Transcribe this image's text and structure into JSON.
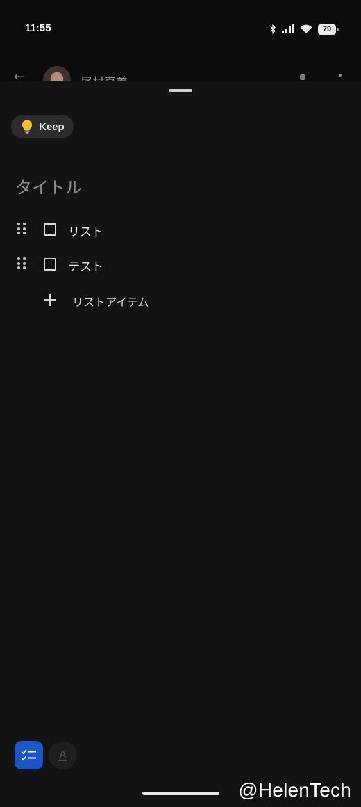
{
  "status_bar": {
    "time": "11:55",
    "battery": "79",
    "icons": [
      "bluetooth-icon",
      "cellular-signal-icon",
      "wifi-icon",
      "battery-icon"
    ]
  },
  "background_app": {
    "back_icon": "back-arrow-icon",
    "contact_name": "尾村直美"
  },
  "sheet": {
    "chip": {
      "label": "Keep",
      "icon": "lightbulb-icon",
      "icon_color": "#f6c02b"
    },
    "title_placeholder": "タイトル",
    "items": [
      {
        "text": "リスト",
        "checked": false
      },
      {
        "text": "テスト",
        "checked": false
      }
    ],
    "add_item_label": "リストアイテム"
  },
  "toolbar": {
    "checklist_icon": "checklist-icon",
    "text_format_glyph": "A",
    "accent": "#1a56c7"
  },
  "watermark": "@HelenTech"
}
